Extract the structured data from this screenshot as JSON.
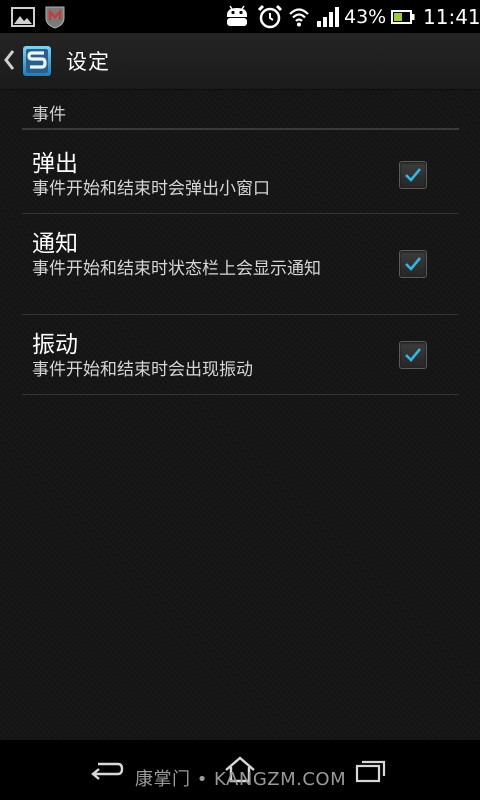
{
  "status_bar": {
    "battery_percent": "43%",
    "time": "11:41",
    "icons": [
      "gallery-icon",
      "mcafee-icon",
      "android-icon",
      "alarm-icon",
      "wifi-icon",
      "signal-icon",
      "battery-icon"
    ]
  },
  "action_bar": {
    "title": "设定",
    "back_icon": "chevron-left-icon",
    "app_icon": "app-logo-icon"
  },
  "section": {
    "header": "事件"
  },
  "preferences": [
    {
      "title": "弹出",
      "summary": "事件开始和结束时会弹出小窗口",
      "checked": true
    },
    {
      "title": "通知",
      "summary": "事件开始和结束时状态栏上会显示通知",
      "checked": true
    },
    {
      "title": "振动",
      "summary": "事件开始和结束时会出现振动",
      "checked": true
    }
  ],
  "nav_bar": {
    "watermark": "康掌门 • KANGZM.COM",
    "icons": [
      "back-icon",
      "home-icon",
      "recent-apps-icon"
    ]
  },
  "colors": {
    "accent": "#33b5e5",
    "background": "#151515",
    "divider": "#333333"
  }
}
